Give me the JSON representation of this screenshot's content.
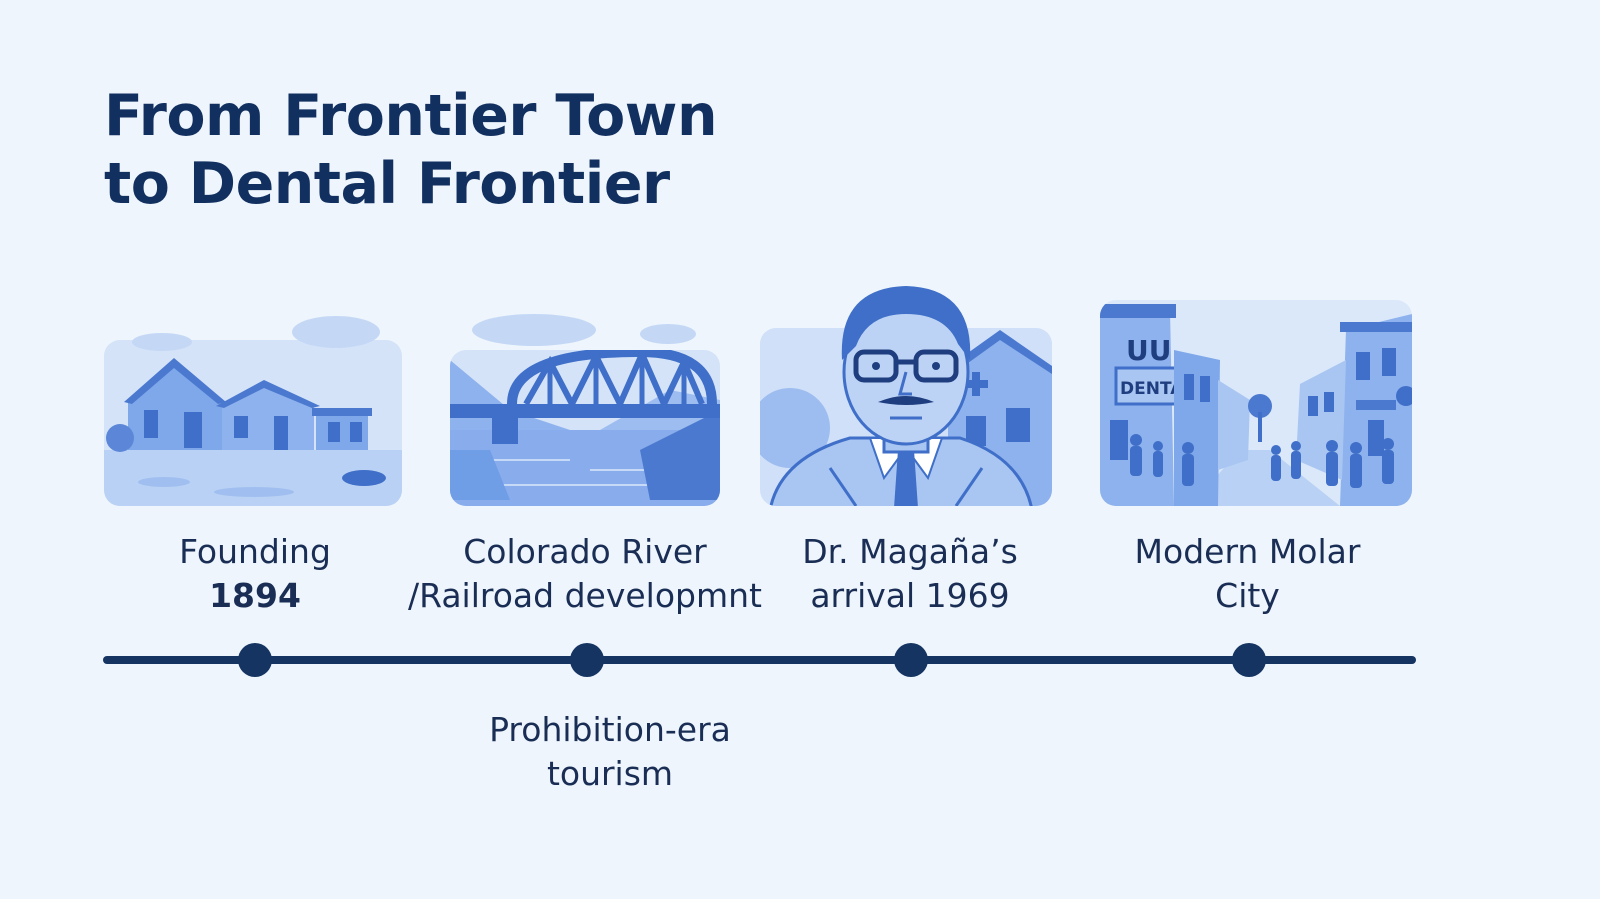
{
  "title": {
    "line1": "From Frontier Town",
    "line2": "to Dental Frontier"
  },
  "events": [
    {
      "line1": "Founding",
      "line2": "1894"
    },
    {
      "line1": "Colorado River",
      "line2": "/Railroad developmnt"
    },
    {
      "line1": "Dr. Magaña’s",
      "line2": "arrival 1969"
    },
    {
      "line1": "Modern Molar",
      "line2": "City"
    }
  ],
  "below_event": {
    "line1": "Prohibition-era",
    "line2": "tourism"
  },
  "illustrations": {
    "dental_sign_top": "UU",
    "dental_sign": "DENTAL"
  },
  "colors": {
    "background": "#eef5fc",
    "title": "#12305f",
    "timeline": "#153462",
    "illustration_light": "#a9c6f2",
    "illustration_mid": "#6f9ee6",
    "illustration_dark": "#3f6fc8"
  }
}
